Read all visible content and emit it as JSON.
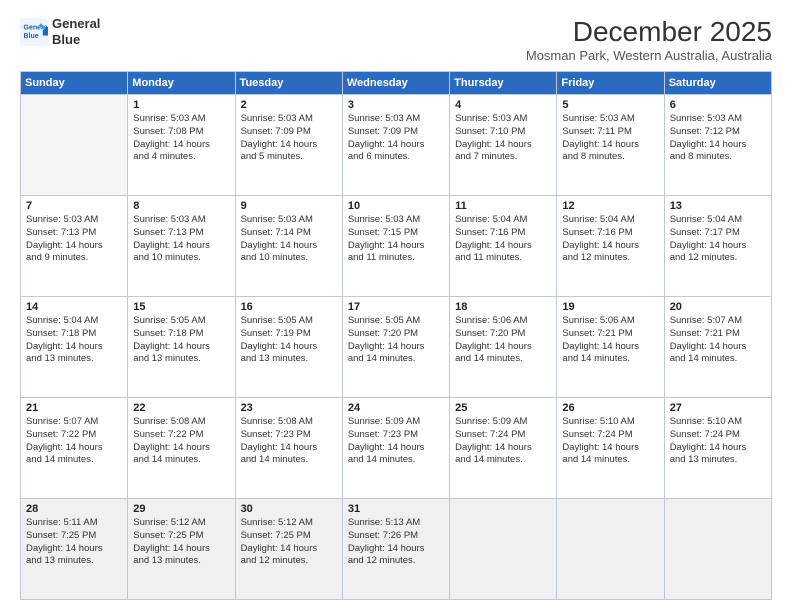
{
  "logo": {
    "line1": "General",
    "line2": "Blue"
  },
  "title": "December 2025",
  "subtitle": "Mosman Park, Western Australia, Australia",
  "days_of_week": [
    "Sunday",
    "Monday",
    "Tuesday",
    "Wednesday",
    "Thursday",
    "Friday",
    "Saturday"
  ],
  "weeks": [
    [
      {
        "day": "",
        "info": ""
      },
      {
        "day": "1",
        "info": "Sunrise: 5:03 AM\nSunset: 7:08 PM\nDaylight: 14 hours\nand 4 minutes."
      },
      {
        "day": "2",
        "info": "Sunrise: 5:03 AM\nSunset: 7:09 PM\nDaylight: 14 hours\nand 5 minutes."
      },
      {
        "day": "3",
        "info": "Sunrise: 5:03 AM\nSunset: 7:09 PM\nDaylight: 14 hours\nand 6 minutes."
      },
      {
        "day": "4",
        "info": "Sunrise: 5:03 AM\nSunset: 7:10 PM\nDaylight: 14 hours\nand 7 minutes."
      },
      {
        "day": "5",
        "info": "Sunrise: 5:03 AM\nSunset: 7:11 PM\nDaylight: 14 hours\nand 8 minutes."
      },
      {
        "day": "6",
        "info": "Sunrise: 5:03 AM\nSunset: 7:12 PM\nDaylight: 14 hours\nand 8 minutes."
      }
    ],
    [
      {
        "day": "7",
        "info": "Sunrise: 5:03 AM\nSunset: 7:13 PM\nDaylight: 14 hours\nand 9 minutes."
      },
      {
        "day": "8",
        "info": "Sunrise: 5:03 AM\nSunset: 7:13 PM\nDaylight: 14 hours\nand 10 minutes."
      },
      {
        "day": "9",
        "info": "Sunrise: 5:03 AM\nSunset: 7:14 PM\nDaylight: 14 hours\nand 10 minutes."
      },
      {
        "day": "10",
        "info": "Sunrise: 5:03 AM\nSunset: 7:15 PM\nDaylight: 14 hours\nand 11 minutes."
      },
      {
        "day": "11",
        "info": "Sunrise: 5:04 AM\nSunset: 7:16 PM\nDaylight: 14 hours\nand 11 minutes."
      },
      {
        "day": "12",
        "info": "Sunrise: 5:04 AM\nSunset: 7:16 PM\nDaylight: 14 hours\nand 12 minutes."
      },
      {
        "day": "13",
        "info": "Sunrise: 5:04 AM\nSunset: 7:17 PM\nDaylight: 14 hours\nand 12 minutes."
      }
    ],
    [
      {
        "day": "14",
        "info": "Sunrise: 5:04 AM\nSunset: 7:18 PM\nDaylight: 14 hours\nand 13 minutes."
      },
      {
        "day": "15",
        "info": "Sunrise: 5:05 AM\nSunset: 7:18 PM\nDaylight: 14 hours\nand 13 minutes."
      },
      {
        "day": "16",
        "info": "Sunrise: 5:05 AM\nSunset: 7:19 PM\nDaylight: 14 hours\nand 13 minutes."
      },
      {
        "day": "17",
        "info": "Sunrise: 5:05 AM\nSunset: 7:20 PM\nDaylight: 14 hours\nand 14 minutes."
      },
      {
        "day": "18",
        "info": "Sunrise: 5:06 AM\nSunset: 7:20 PM\nDaylight: 14 hours\nand 14 minutes."
      },
      {
        "day": "19",
        "info": "Sunrise: 5:06 AM\nSunset: 7:21 PM\nDaylight: 14 hours\nand 14 minutes."
      },
      {
        "day": "20",
        "info": "Sunrise: 5:07 AM\nSunset: 7:21 PM\nDaylight: 14 hours\nand 14 minutes."
      }
    ],
    [
      {
        "day": "21",
        "info": "Sunrise: 5:07 AM\nSunset: 7:22 PM\nDaylight: 14 hours\nand 14 minutes."
      },
      {
        "day": "22",
        "info": "Sunrise: 5:08 AM\nSunset: 7:22 PM\nDaylight: 14 hours\nand 14 minutes."
      },
      {
        "day": "23",
        "info": "Sunrise: 5:08 AM\nSunset: 7:23 PM\nDaylight: 14 hours\nand 14 minutes."
      },
      {
        "day": "24",
        "info": "Sunrise: 5:09 AM\nSunset: 7:23 PM\nDaylight: 14 hours\nand 14 minutes."
      },
      {
        "day": "25",
        "info": "Sunrise: 5:09 AM\nSunset: 7:24 PM\nDaylight: 14 hours\nand 14 minutes."
      },
      {
        "day": "26",
        "info": "Sunrise: 5:10 AM\nSunset: 7:24 PM\nDaylight: 14 hours\nand 14 minutes."
      },
      {
        "day": "27",
        "info": "Sunrise: 5:10 AM\nSunset: 7:24 PM\nDaylight: 14 hours\nand 13 minutes."
      }
    ],
    [
      {
        "day": "28",
        "info": "Sunrise: 5:11 AM\nSunset: 7:25 PM\nDaylight: 14 hours\nand 13 minutes."
      },
      {
        "day": "29",
        "info": "Sunrise: 5:12 AM\nSunset: 7:25 PM\nDaylight: 14 hours\nand 13 minutes."
      },
      {
        "day": "30",
        "info": "Sunrise: 5:12 AM\nSunset: 7:25 PM\nDaylight: 14 hours\nand 12 minutes."
      },
      {
        "day": "31",
        "info": "Sunrise: 5:13 AM\nSunset: 7:26 PM\nDaylight: 14 hours\nand 12 minutes."
      },
      {
        "day": "",
        "info": ""
      },
      {
        "day": "",
        "info": ""
      },
      {
        "day": "",
        "info": ""
      }
    ]
  ]
}
